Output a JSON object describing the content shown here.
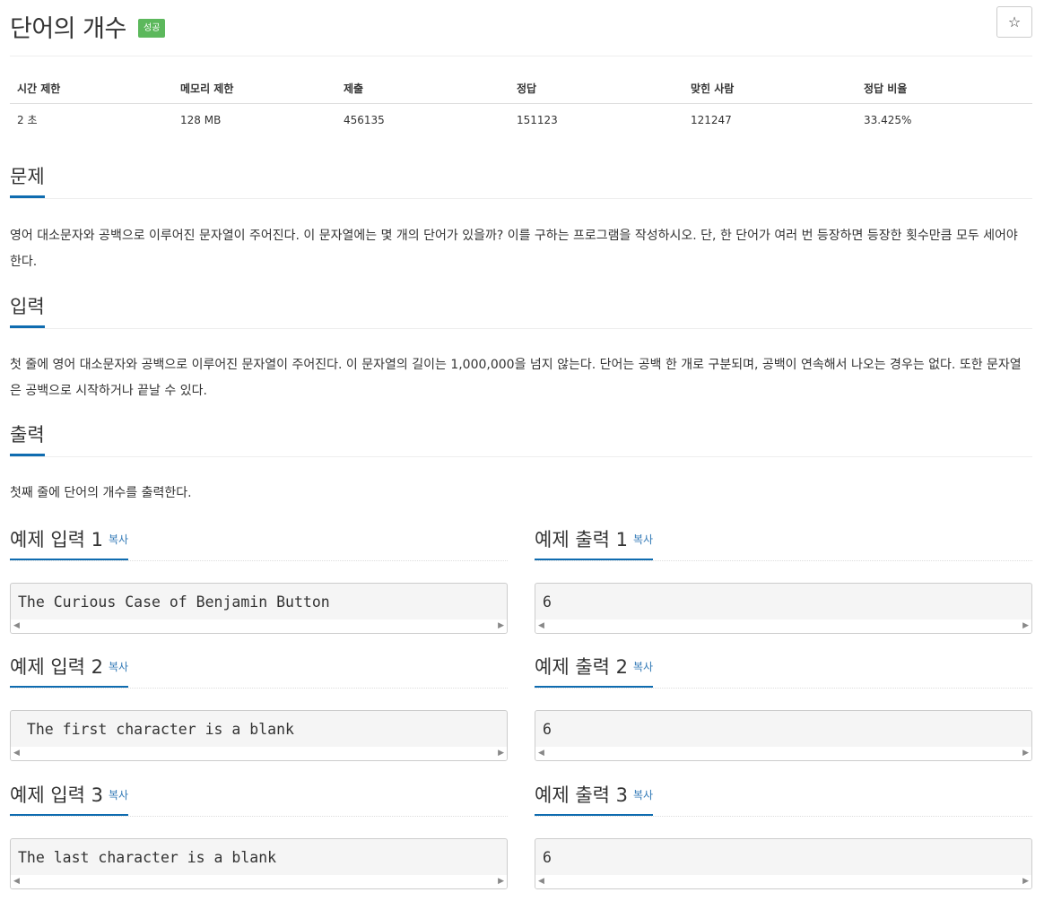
{
  "problem": {
    "title": "단어의 개수",
    "badge": "성공",
    "favorite_icon": "star-outline-icon",
    "favorite_glyph": "☆"
  },
  "stats": {
    "headers": [
      "시간 제한",
      "메모리 제한",
      "제출",
      "정답",
      "맞힌 사람",
      "정답 비율"
    ],
    "values": [
      "2 초",
      "128 MB",
      "456135",
      "151123",
      "121247",
      "33.425%"
    ]
  },
  "sections": {
    "description": {
      "heading": "문제",
      "text": "영어 대소문자와 공백으로 이루어진 문자열이 주어진다. 이 문자열에는 몇 개의 단어가 있을까? 이를 구하는 프로그램을 작성하시오. 단, 한 단어가 여러 번 등장하면 등장한 횟수만큼 모두 세어야 한다."
    },
    "input": {
      "heading": "입력",
      "text": "첫 줄에 영어 대소문자와 공백으로 이루어진 문자열이 주어진다. 이 문자열의 길이는 1,000,000을 넘지 않는다. 단어는 공백 한 개로 구분되며, 공백이 연속해서 나오는 경우는 없다. 또한 문자열은 공백으로 시작하거나 끝날 수 있다."
    },
    "output": {
      "heading": "출력",
      "text": "첫째 줄에 단어의 개수를 출력한다."
    }
  },
  "examples": {
    "copy_label": "복사",
    "scroll_left_glyph": "◀",
    "scroll_right_glyph": "▶",
    "items": [
      {
        "input_title": "예제 입력 1",
        "input": "The Curious Case of Benjamin Button",
        "output_title": "예제 출력 1",
        "output": "6"
      },
      {
        "input_title": "예제 입력 2",
        "input": " The first character is a blank",
        "output_title": "예제 출력 2",
        "output": "6"
      },
      {
        "input_title": "예제 입력 3",
        "input": "The last character is a blank ",
        "output_title": "예제 출력 3",
        "output": "6"
      }
    ]
  }
}
